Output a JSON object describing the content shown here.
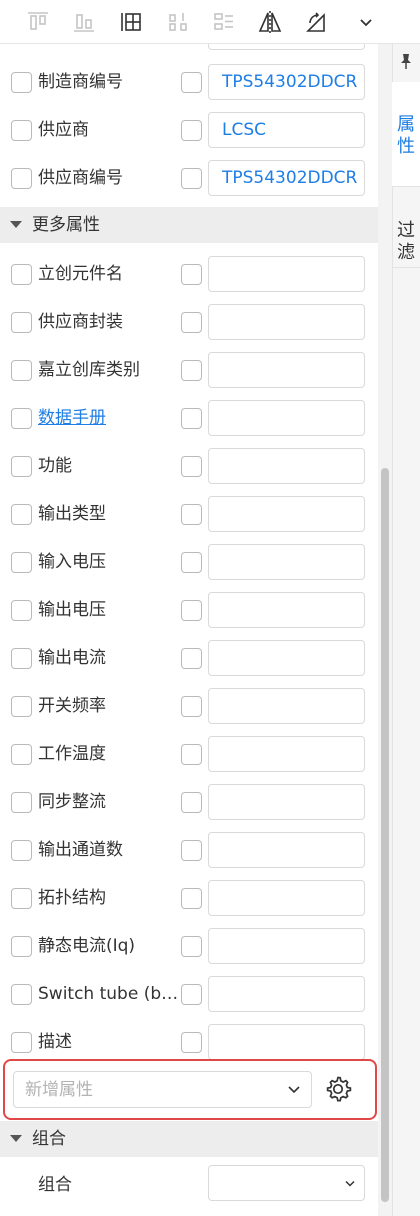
{
  "toolbar": {
    "buttons": [
      {
        "name": "align-top-icon"
      },
      {
        "name": "align-bottom-icon"
      },
      {
        "name": "table-grid-icon"
      },
      {
        "name": "distribute-vertical-icon"
      },
      {
        "name": "distribute-horizontal-icon"
      },
      {
        "name": "flip-horizontal-icon"
      },
      {
        "name": "flip-vertical-icon"
      },
      {
        "name": "chevron-down-icon"
      }
    ]
  },
  "basic_rows": [
    {
      "label": "制造商编号",
      "value": "TPS54302DDCR"
    },
    {
      "label": "供应商",
      "value": "LCSC"
    },
    {
      "label": "供应商编号",
      "value": "TPS54302DDCR"
    }
  ],
  "more_section": {
    "label": "更多属性"
  },
  "more_rows": [
    {
      "label": "立创元件名",
      "value": ""
    },
    {
      "label": "供应商封装",
      "value": ""
    },
    {
      "label": "嘉立创库类别",
      "value": ""
    },
    {
      "label": "数据手册",
      "value": "",
      "link": true
    },
    {
      "label": "功能",
      "value": ""
    },
    {
      "label": "输出类型",
      "value": ""
    },
    {
      "label": "输入电压",
      "value": ""
    },
    {
      "label": "输出电压",
      "value": ""
    },
    {
      "label": "输出电流",
      "value": ""
    },
    {
      "label": "开关频率",
      "value": ""
    },
    {
      "label": "工作温度",
      "value": ""
    },
    {
      "label": "同步整流",
      "value": ""
    },
    {
      "label": "输出通道数",
      "value": ""
    },
    {
      "label": "拓扑结构",
      "value": ""
    },
    {
      "label": "静态电流(Iq)",
      "value": ""
    },
    {
      "label": "Switch tube (bu…",
      "value": ""
    },
    {
      "label": "描述",
      "value": ""
    }
  ],
  "add_property": {
    "placeholder": "新增属性"
  },
  "group_section": {
    "label": "组合"
  },
  "group_row": {
    "label": "组合",
    "value": ""
  },
  "side_tabs": {
    "properties": "属性",
    "filter": "过滤"
  },
  "colors": {
    "accent": "#1d7ee6",
    "highlight_border": "#e04848",
    "section_bg": "#ededed"
  }
}
